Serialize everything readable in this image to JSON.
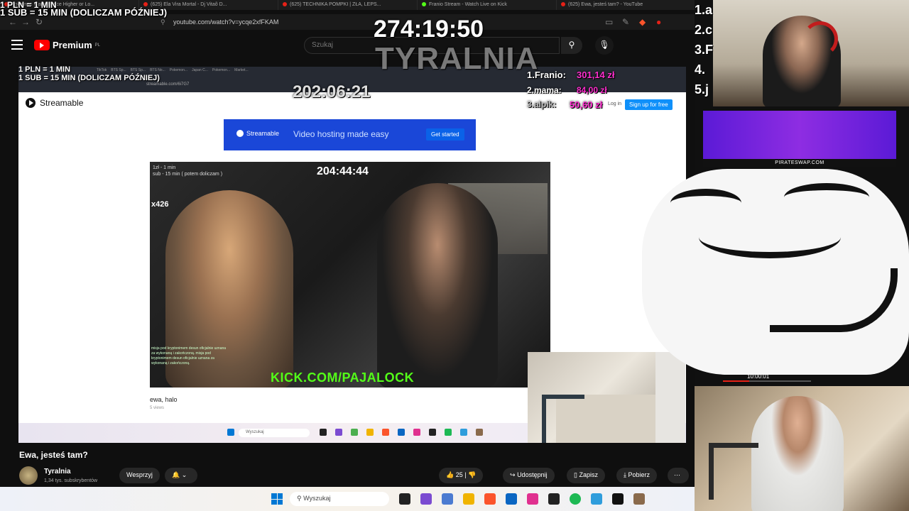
{
  "browser": {
    "tabs": [
      "Pokemon Market Price Higher or Lo...",
      "(625) Ela Vira Mortal - Dj Vitaõ D...",
      "(625) TECHNIKA POMPKI | ZŁA, LEPS...",
      "Franio Stream - Watch Live on Kick",
      "(625) Ewa, jesteś tam? - YouTube"
    ],
    "url": "youtube.com/watch?v=ycqe2xfFKAM"
  },
  "youtube": {
    "brand": "Premium",
    "brand_region": "PL",
    "search_placeholder": "Szukaj",
    "video_title": "Ewa, jesteś tam?",
    "channel_name": "Tyralnia",
    "channel_subs": "1,34 tys. subskrybentów",
    "join_label": "Wesprzyj",
    "like_count": "25",
    "share_label": "Udostępnij",
    "save_label": "Zapisz",
    "download_label": "Pobierz"
  },
  "inner_capture": {
    "url": "streamable.com/6i7G7",
    "tabs": [
      "TikTok",
      "BTS Sp...",
      "BTS Sp...",
      "BTS No...",
      "Pokemon...",
      "Japan C...",
      "Pokemon...",
      "Market..."
    ]
  },
  "streamable": {
    "logo": "Streamable",
    "login": "Log in",
    "signup": "Sign up for free",
    "banner_logo": "Streamable",
    "banner_text": "Video hosting made easy",
    "banner_cta": "Get started",
    "video_overlay_line1": "1zł - 1 min",
    "video_overlay_line2": "sub - 15 min ( potem doliczam )",
    "video_timer": "204:44:44",
    "video_badge": "x426",
    "video_kick": "KICK.COM/PAJALOCK",
    "video_chat": "misja pod kryptonimem desun oficjalnie uznana za wykonaną i zakończoną. misja pod kryptonimem desun oficjalnie uznana za wykonaną i zakończoną.",
    "clip_title": "ewa, halo",
    "clip_views": "5 views",
    "inner_search": "Wyszukaj"
  },
  "overlays": {
    "pln_top": "1 PLN = 1 MIN",
    "sub_top": "1 SUB = 15 MIN (DOLICZAM PÓŹNIEJ)",
    "timer_main": "274:19:50",
    "channel_watermark": "TYRALNIA",
    "pln_inner": "1 PLN = 1 MIN",
    "sub_inner": "1 SUB = 15 MIN (DOLICZAM PÓŹNIEJ)",
    "timer_inner": "202:06:21",
    "rank1_name": "1.Franio:",
    "rank1_value": "301,14 zł",
    "rank2_name": "2.mama:",
    "rank2_value": "84,00 zł",
    "rank3_name": "3.alpik:",
    "rank3_value": "50,60 zł"
  },
  "right_column": {
    "rank_letters": [
      "1.a",
      "2.c",
      "3.F",
      "4.",
      "5.j"
    ],
    "pirate_label": "PIRATESWAP.COM",
    "mini_timer": "10:00:01",
    "mini_progress": 0.3
  },
  "taskbar": {
    "search_placeholder": "Wyszukaj"
  },
  "colors": {
    "youtube_red": "#ff0000",
    "kick_green": "#53fc18",
    "overlay_pink": "#ff2fd0",
    "streamable_blue": "#1a47d8"
  }
}
